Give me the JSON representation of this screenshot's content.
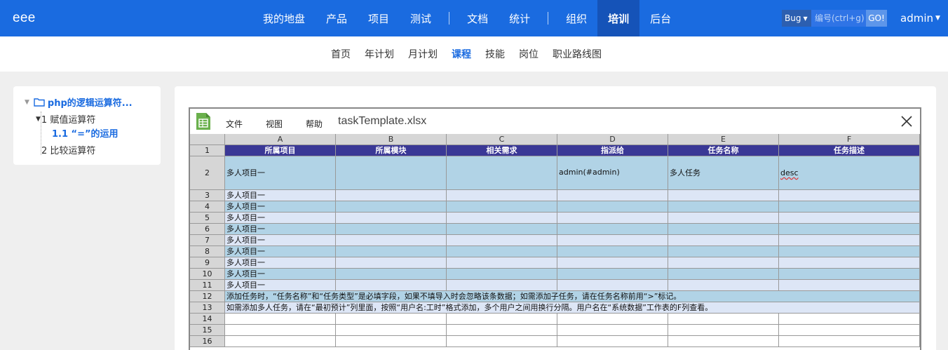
{
  "app": {
    "brand": "eee"
  },
  "topnav": {
    "items": [
      "我的地盘",
      "产品",
      "项目",
      "测试",
      "文档",
      "统计",
      "组织",
      "培训",
      "后台"
    ],
    "active": "培训"
  },
  "search": {
    "type_label": "Bug",
    "placeholder": "编号(ctrl+g)",
    "go_label": "GO!"
  },
  "user": {
    "name": "admin"
  },
  "subnav": {
    "items": [
      "首页",
      "年计划",
      "月计划",
      "课程",
      "技能",
      "岗位",
      "职业路线图"
    ],
    "active": "课程"
  },
  "tree": {
    "root": "php的逻辑运算符...",
    "child1": "1 赋值运算符",
    "child1_1": "1.1 “=”的运用",
    "child2": "2 比较运算符"
  },
  "sheet": {
    "menu": [
      "文件",
      "视图",
      "帮助"
    ],
    "filename": "taskTemplate.xlsx",
    "columns": [
      "A",
      "B",
      "C",
      "D",
      "E",
      "F"
    ],
    "row_numbers": [
      "1",
      "2",
      "3",
      "4",
      "5",
      "6",
      "7",
      "8",
      "9",
      "10",
      "11",
      "12",
      "13",
      "14",
      "15",
      "16"
    ],
    "headers": [
      "所属项目",
      "所属模块",
      "相关需求",
      "指派给",
      "任务名称",
      "任务描述"
    ],
    "row2": [
      "多人项目一",
      "",
      "",
      "admin(#admin)",
      "多人任务",
      "desc"
    ],
    "repeat_value": "多人项目一",
    "note12": "添加任务时，“任务名称”和“任务类型”是必填字段，如果不填导入时会忽略该条数据；如需添加子任务，请在任务名称前用“>”标记。",
    "note13": "如需添加多人任务，请在“最初预计”列里面，按照“用户名:工时”格式添加，多个用户之间用换行分隔。用户名在“系统数据”工作表的F列查看。"
  },
  "colors": {
    "brand_blue": "#1a6be0",
    "header_purple": "#3a3896",
    "row_blue": "#b1d3e6",
    "row_light": "#dde6f6",
    "sheet_green": "#6ab04c"
  }
}
